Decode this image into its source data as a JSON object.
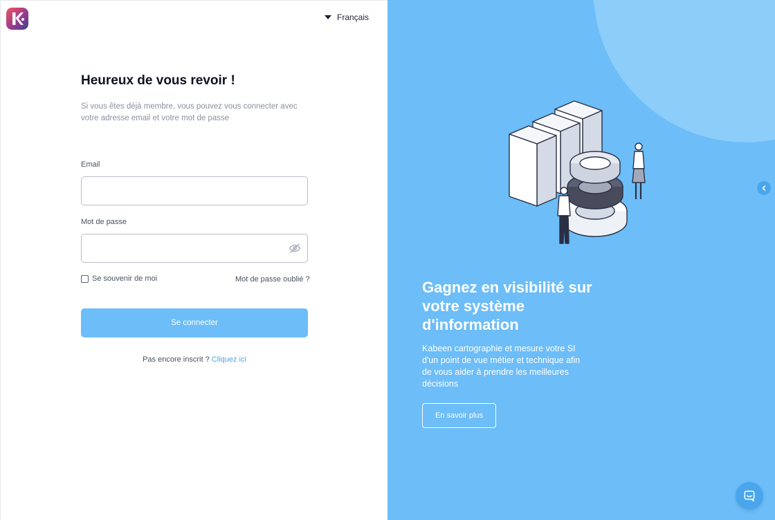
{
  "language": {
    "selected": "Français"
  },
  "login": {
    "title": "Heureux de vous revoir !",
    "subtitle": "Si vous êtes déjà membre, vous pouvez vous connecter avec votre adresse email et votre mot de passe",
    "email_label": "Email",
    "email_value": "",
    "password_label": "Mot de passe",
    "password_value": "",
    "remember_label": "Se souvenir de moi",
    "remember_checked": false,
    "forgot_label": "Mot de passe oublié ?",
    "submit_label": "Se connecter",
    "signup_prompt": "Pas encore inscrit ?",
    "signup_link": "Cliquez ici"
  },
  "promo": {
    "title": "Gagnez en visibilité sur votre système d'information",
    "text": "Kabeen cartographie et mesure votre SI d'un point de vue métier et technique afin de vous aider à prendre les meilleures décisions",
    "button_label": "En savoir plus"
  },
  "icons": {
    "logo": "kabeen-logo-icon",
    "language_caret": "caret-down-icon",
    "password_toggle": "eye-slash-icon",
    "collapse": "chevron-left-icon",
    "chat": "chat-icon"
  },
  "colors": {
    "accent": "#6cbdf8",
    "accent_dark": "#4aa6ec",
    "panel": "#6cbdf8",
    "text_dark": "#0f1220"
  }
}
